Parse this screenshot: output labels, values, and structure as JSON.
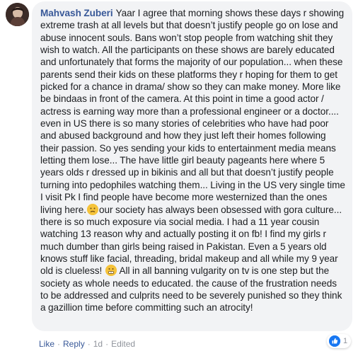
{
  "comment": {
    "author": "Mahvash Zuberi",
    "text_part1": "Yaar I agree that morning shows these days r showing extreme trash at all levels but that doesn’t justify people go on lose and abuse innocent souls. Bans won’t stop people from watching shit they wish to watch. All the participants on these shows are barely educated and unfortunately that forms the majority of our population... when these parents send their kids on these platforms they r hoping for them to get picked for a chance in drama/ show so they can make money. More like be bindaas in front of the camera. At this point in time a good actor / actress is earning way more than a professional engineer or a doctor.... even in US there is so many stories of celebrities who have had poor and abused background and how they just left their homes following their passion. So yes sending your kids to entertainment media means letting them lose... The have little girl beauty pageants here where 5 years olds r dressed up in bikinis and all but that doesn’t justify people turning into pedophiles watching them... Living in the US very single time I visit Pk I find people have become more westernized than the ones living here.",
    "emoji1": "worried-face-emoji",
    "text_part2": "our society has always been obsessed with gora culture... there is so much exposure via social media. I had a 11 year cousin watching 13 reason why and actually posting it on fb! I find my girls r much dumber than girls being raised in Pakistan. Even a 5 years old knows stuff like facial, threading, bridal makeup and all while my 9 year old is clueless!",
    "emoji2": "grimacing-face-emoji",
    "text_part3": "All in all banning vulgarity on tv is one step but the society as whole needs to educated. the cause of the frustration needs to be addressed and culprits need to be severely punished so they think a gazillion time before committing such an atrocity!"
  },
  "actions": {
    "like": "Like",
    "separator": "·",
    "reply": "Reply",
    "time": "1d",
    "edited": "Edited"
  },
  "reactions": {
    "icon": "like-icon",
    "count": "1",
    "color": "#1877f2"
  },
  "colors": {
    "bubble": "#f2f3f5",
    "author": "#385898",
    "text": "#1c1e21"
  }
}
